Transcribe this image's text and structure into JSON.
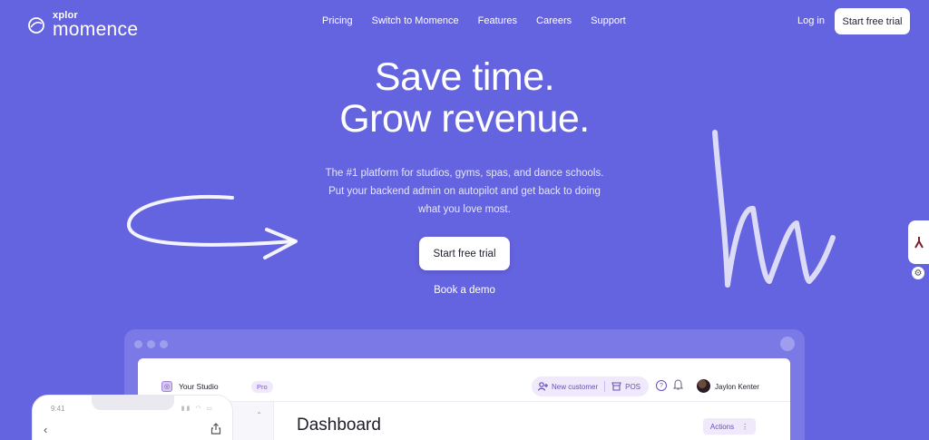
{
  "colors": {
    "background": "#6463e0",
    "accent": "#6a4fb5",
    "button": "#ffffff"
  },
  "header": {
    "brand_small": "xplor",
    "brand_big": "momence",
    "nav": [
      "Pricing",
      "Switch to Momence",
      "Features",
      "Careers",
      "Support"
    ],
    "login": "Log in",
    "cta": "Start free trial"
  },
  "hero": {
    "title_line1": "Save time.",
    "title_line2": "Grow revenue.",
    "sub_line1": "The #1 platform for studios, gyms, spas, and dance schools.",
    "sub_line2": "Put your backend admin on autopilot and get back to doing",
    "sub_line3": "what you love most.",
    "cta": "Start free trial",
    "demo": "Book a demo"
  },
  "dashboard": {
    "studio_name": "Your Studio",
    "badge": "Pro",
    "new_customer": "New customer",
    "pos": "POS",
    "user_name": "Jaylon Kenter",
    "title": "Dashboard",
    "actions": "Actions"
  },
  "phone": {
    "time": "9:41"
  },
  "icons": [
    "logo-ring-icon",
    "person-plus-icon",
    "shop-icon",
    "help-icon",
    "bell-icon",
    "chevron-left-icon",
    "share-icon",
    "gear-icon",
    "brand-widget-icon"
  ]
}
